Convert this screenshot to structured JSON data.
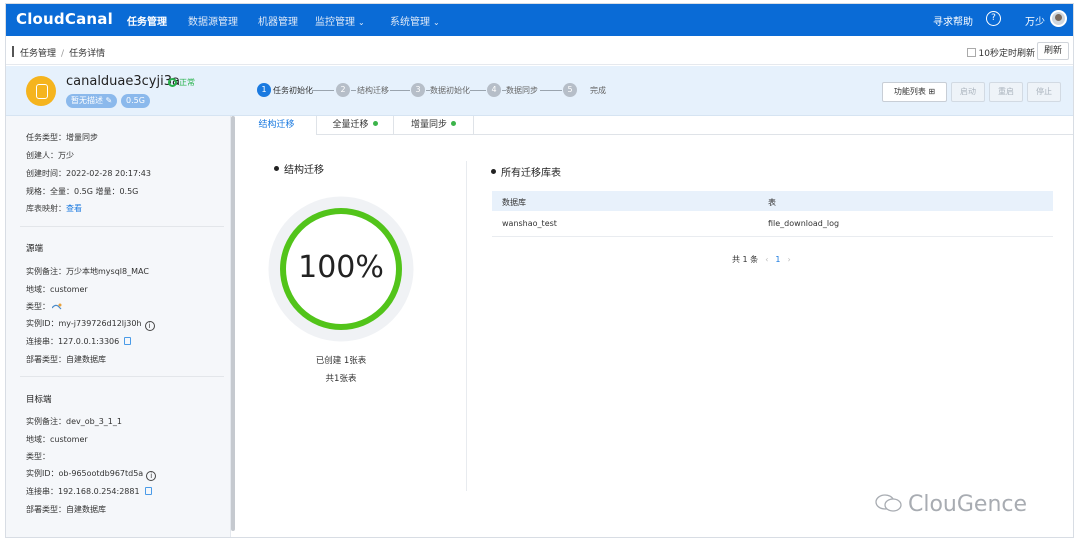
{
  "topnav": {
    "logo": "CloudCanal",
    "items": [
      "任务管理",
      "数据源管理",
      "机器管理",
      "监控管理",
      "系统管理"
    ],
    "help": "寻求帮助",
    "help_icon": "?",
    "user": "万少"
  },
  "breadcrumb": {
    "items": [
      "任务管理",
      "任务详情"
    ],
    "separator": "/",
    "auto_refresh": "10秒定时刷新",
    "refresh": "刷新"
  },
  "task": {
    "id": "canalduae3cyji3a",
    "status": "正常",
    "desc_tag": "暂无描述",
    "spec_tag": "0.5G",
    "steps": [
      {
        "num": "1",
        "label": "任务初始化"
      },
      {
        "num": "2",
        "label": "结构迁移"
      },
      {
        "num": "3",
        "label": "数据初始化"
      },
      {
        "num": "4",
        "label": "数据同步"
      },
      {
        "num": "5",
        "label": "完成"
      }
    ],
    "buttons": {
      "funclist": "功能列表 ⊞",
      "start": "启动",
      "restart": "重启",
      "stop": "停止"
    }
  },
  "sidebar": {
    "general": {
      "type": "任务类型：增量同步",
      "creator": "创建人：万少",
      "created": "创建时间：2022-02-28 20:17:43",
      "spec": "规格：全量：0.5G 增量：0.5G",
      "mapping_label": "库表映射：",
      "mapping_link": "查看"
    },
    "source": {
      "title": "源端",
      "remark": "实例备注：万少本地mysql8_MAC",
      "region": "地域：customer",
      "type": "类型：",
      "instance": "实例ID：my-j739726d12lj30h",
      "conn": "连接串：127.0.0.1:3306",
      "deploy": "部署类型：自建数据库"
    },
    "target": {
      "title": "目标端",
      "remark": "实例备注：dev_ob_3_1_1",
      "region": "地域：customer",
      "type": "类型：",
      "instance": "实例ID：ob-965ootdb967td5a",
      "conn": "连接串：192.168.0.254:2881",
      "deploy": "部署类型：自建数据库"
    }
  },
  "tabs": [
    "结构迁移",
    "全量迁移",
    "增量同步"
  ],
  "migration": {
    "title": "结构迁移",
    "progress": 100,
    "progress_text": "100%",
    "created": "已创建 1张表",
    "total": "共1张表",
    "colors": {
      "ring": "#52c41a",
      "ring_bg": "#f0f2f5"
    }
  },
  "tables": {
    "title": "所有迁移库表",
    "headers": [
      "数据库",
      "表"
    ],
    "rows": [
      [
        "wanshao_test",
        "file_download_log"
      ]
    ],
    "pager": {
      "total": "共 1 条",
      "prev": "‹",
      "page": "1",
      "next": "›"
    }
  },
  "watermark": "ClouGence"
}
